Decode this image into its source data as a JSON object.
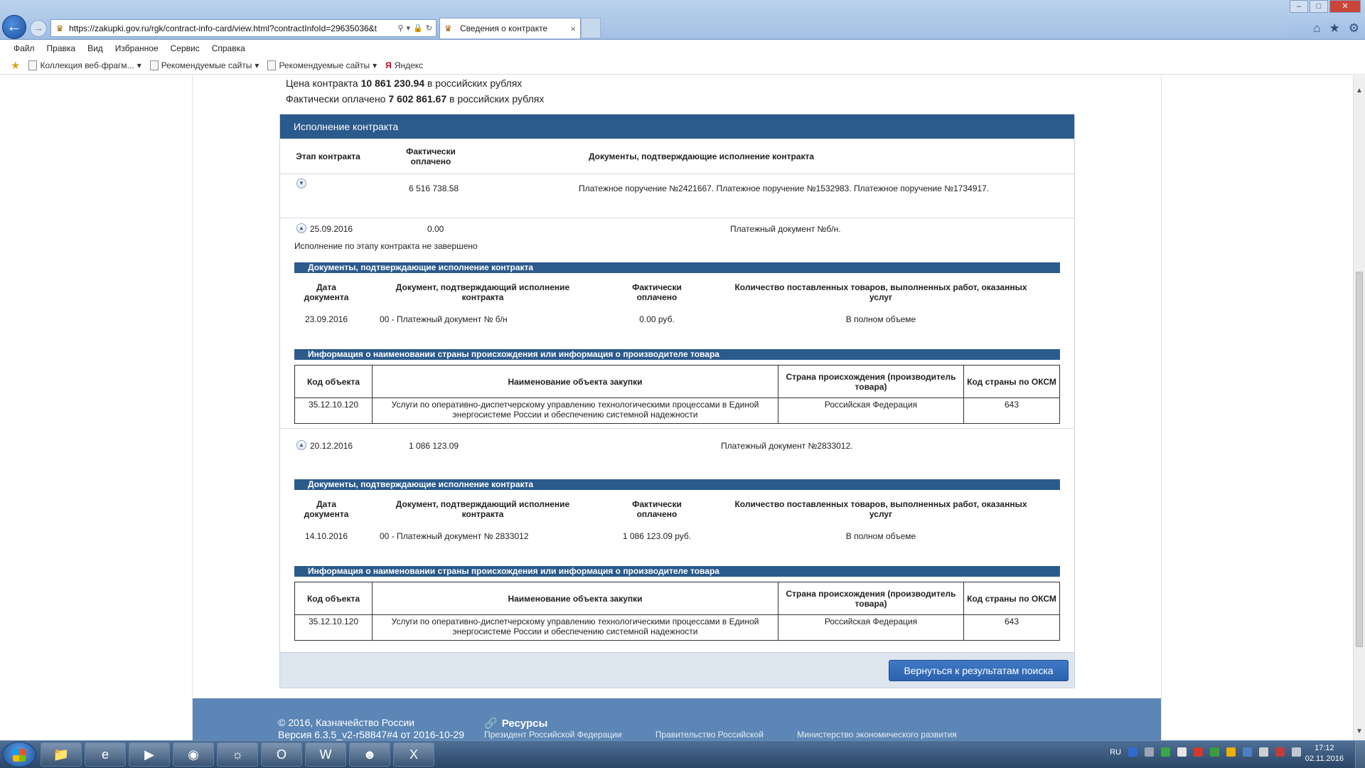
{
  "browser": {
    "url": "https://zakupki.gov.ru/rgk/contract-info-card/view.html?contractInfoId=29635036&t",
    "tab_title": "Сведения о контракте",
    "tab_close": "×",
    "menu": [
      "Файл",
      "Правка",
      "Вид",
      "Избранное",
      "Сервис",
      "Справка"
    ],
    "favorites": [
      {
        "label": "Коллекция веб-фрагм...",
        "has_dropdown": true
      },
      {
        "label": "Рекомендуемые сайты",
        "has_dropdown": true
      },
      {
        "label": "Рекомендуемые сайты",
        "has_dropdown": true
      },
      {
        "label": "Яндекс",
        "has_dropdown": false
      }
    ]
  },
  "contract": {
    "price_prefix": "Цена контракта",
    "price_value": "10 861 230.94",
    "price_suffix": "в российских рублях",
    "paid_prefix": "Фактически оплачено",
    "paid_value": "7 602 861.67",
    "paid_suffix": "в российских рублях"
  },
  "execution": {
    "title": "Исполнение контракта",
    "col_stage": "Этап контракта",
    "col_paid": "Фактически оплачено",
    "col_docs": "Документы, подтверждающие исполнение контракта",
    "summary_row": {
      "paid": "6 516 738.58",
      "docs": "Платежное поручение №2421667. Платежное поручение №1532983. Платежное поручение №1734917."
    },
    "stages": [
      {
        "date": "25.09.2016",
        "paid": "0.00",
        "docs": "Платежный документ №б/н.",
        "status": "Исполнение по этапу контракта не завершено",
        "docs_section_title": "Документы, подтверждающие исполнение контракта",
        "doc_headers": {
          "date": "Дата документа",
          "doc": "Документ, подтверждающий исполнение контракта",
          "paid": "Фактически оплачено",
          "qty": "Количество поставленных товаров, выполненных работ, оказанных услуг"
        },
        "doc_row": {
          "date": "23.09.2016",
          "doc": "00 - Платежный документ № б/н",
          "paid": "0.00 руб.",
          "qty": "В полном объеме"
        },
        "origin_section_title": "Информация о наименовании страны происхождения или информация о производителе товара",
        "origin_headers": {
          "code": "Код объекта",
          "name": "Наименование объекта закупки",
          "country": "Страна происхождения (производитель товара)",
          "okcm": "Код страны по ОКСМ"
        },
        "origin_row": {
          "code": "35.12.10.120",
          "name": "Услуги по оперативно-диспетчерскому управлению технологическими процессами в Единой энергосистеме России и обеспечению системной надежности",
          "country": "Российская Федерация",
          "okcm": "643"
        }
      },
      {
        "date": "20.12.2016",
        "paid": "1 086 123.09",
        "docs": "Платежный документ №2833012.",
        "status": "",
        "docs_section_title": "Документы, подтверждающие исполнение контракта",
        "doc_headers": {
          "date": "Дата документа",
          "doc": "Документ, подтверждающий исполнение контракта",
          "paid": "Фактически оплачено",
          "qty": "Количество поставленных товаров, выполненных работ, оказанных услуг"
        },
        "doc_row": {
          "date": "14.10.2016",
          "doc": "00 - Платежный документ № 2833012",
          "paid": "1 086 123.09 руб.",
          "qty": "В полном объеме"
        },
        "origin_section_title": "Информация о наименовании страны происхождения или информация о производителе товара",
        "origin_headers": {
          "code": "Код объекта",
          "name": "Наименование объекта закупки",
          "country": "Страна происхождения (производитель товара)",
          "okcm": "Код страны по ОКСМ"
        },
        "origin_row": {
          "code": "35.12.10.120",
          "name": "Услуги по оперативно-диспетчерскому управлению технологическими процессами в Единой энергосистеме России и обеспечению системной надежности",
          "country": "Российская Федерация",
          "okcm": "643"
        }
      }
    ],
    "back_button": "Вернуться к результатам поиска"
  },
  "footer": {
    "copyright": "© 2016, Казначейство России",
    "version": "Версия 6.3.5_v2-r58847#4 от 2016-10-29",
    "resources_title": "Ресурсы",
    "links": [
      "Президент Российской Федерации",
      "Правительство Российской",
      "Министерство экономического развития"
    ]
  },
  "taskbar": {
    "lang": "RU",
    "time": "17:12",
    "date": "02.11.2016",
    "apps": [
      "folder-icon",
      "ie-icon",
      "media-player-icon",
      "chrome-icon",
      "firefox-icon",
      "outlook-icon",
      "word-icon",
      "user-app-icon",
      "excel-icon"
    ]
  },
  "colors": {
    "header_blue": "#2b5a8c",
    "footer_blue": "#5c86b5",
    "button_blue": "#3a72c0"
  }
}
